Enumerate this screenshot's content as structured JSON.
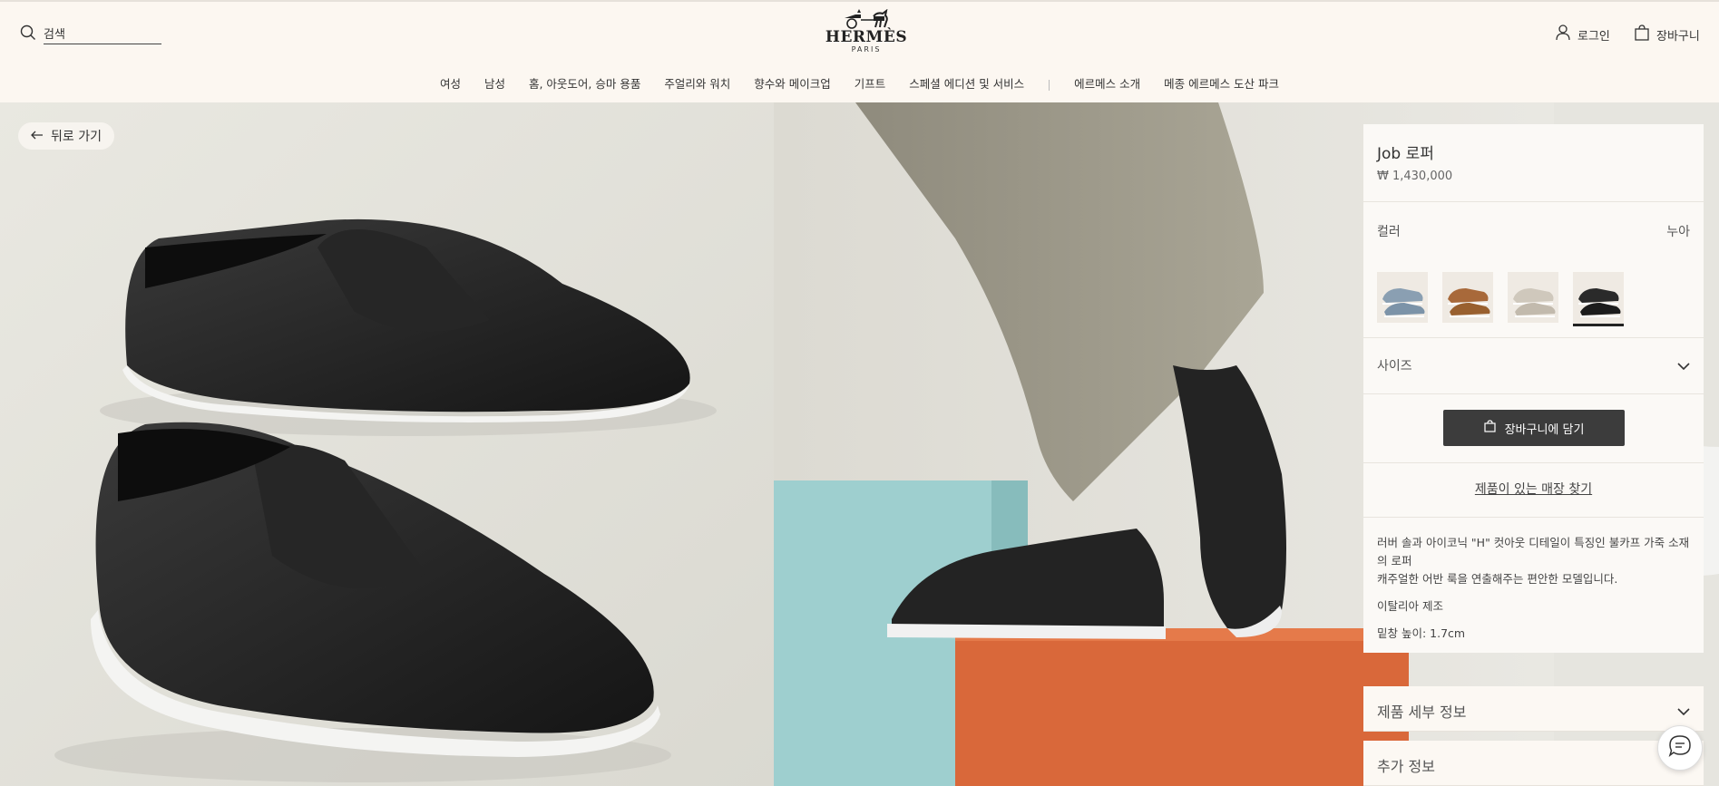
{
  "header": {
    "search": {
      "placeholder": "검색",
      "icon": "search-icon"
    },
    "logo": {
      "name": "HERMÈS",
      "city": "PARIS"
    },
    "login_label": "로그인",
    "cart_label": "장바구니"
  },
  "nav": {
    "items": [
      "여성",
      "남성",
      "홈, 아웃도어, 승마 용품",
      "주얼리와 워치",
      "향수와 메이크업",
      "기프트",
      "스페셜 에디션 및 서비스"
    ],
    "secondary": [
      "에르메스 소개",
      "메종 에르메스 도산 파크"
    ]
  },
  "back_label": "뒤로 가기",
  "product": {
    "title": "Job 로퍼",
    "price": "₩ 1,430,000",
    "color_label": "컬러",
    "color_value": "누아",
    "swatches": [
      {
        "color_name": "blue-grey",
        "color": "#8a9fb2"
      },
      {
        "color_name": "tan",
        "color": "#a8693a"
      },
      {
        "color_name": "beige",
        "color": "#cfc8bc"
      },
      {
        "color_name": "black",
        "color": "#2a2a2a",
        "selected": true
      }
    ],
    "size_label": "사이즈",
    "add_to_cart": "장바구니에 담기",
    "store_link": "제품이 있는 매장 찾기",
    "description": "러버 솔과 아이코닉 \"H\" 컷아웃 디테일이 특징인 불카프 가죽 소재의 로퍼",
    "description2": "캐주얼한 어반 룩을 연출해주는 편안한 모델입니다.",
    "made_in": "이탈리아 제조",
    "sole_height": "밑창 높이: 1.7cm"
  },
  "accordions": {
    "details": "제품 세부 정보",
    "additional": "추가 정보"
  },
  "colors": {
    "background": "#fcf7f1",
    "button_dark": "#3c3c3c",
    "cube_teal": "#9ecfcf",
    "cube_orange": "#d9683a"
  }
}
